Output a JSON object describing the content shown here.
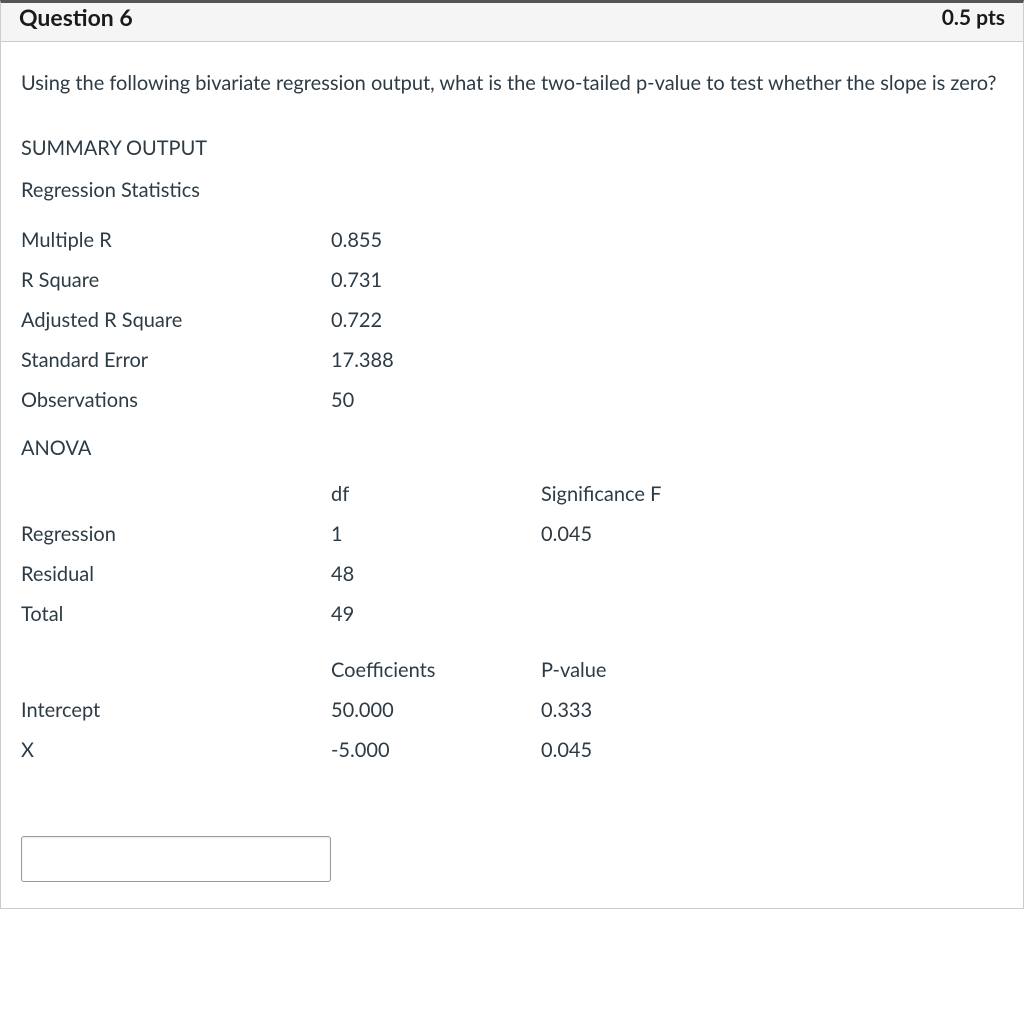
{
  "header": {
    "title": "Question 6",
    "points": "0.5 pts"
  },
  "prompt": "Using the following bivariate regression output, what is the two-tailed p-value to test whether the slope is zero?",
  "summary_heading": "SUMMARY OUTPUT",
  "stats_heading": "Regression Statistics",
  "reg_stats": [
    {
      "label": "Multiple R",
      "value": "0.855"
    },
    {
      "label": "R Square",
      "value": "0.731"
    },
    {
      "label": "Adjusted R Square",
      "value": "0.722"
    },
    {
      "label": "Standard Error",
      "value": "17.388"
    },
    {
      "label": "Observations",
      "value": "50"
    }
  ],
  "anova_heading": "ANOVA",
  "anova": {
    "header": {
      "c0": "",
      "c1": "df",
      "c2": "Significance F"
    },
    "rows": [
      {
        "c0": "Regression",
        "c1": "1",
        "c2": "0.045"
      },
      {
        "c0": "Residual",
        "c1": "48",
        "c2": ""
      },
      {
        "c0": "Total",
        "c1": "49",
        "c2": ""
      }
    ]
  },
  "coef": {
    "header": {
      "c0": "",
      "c1": "Coefficients",
      "c2": "P-value"
    },
    "rows": [
      {
        "c0": "Intercept",
        "c1": "50.000",
        "c2": "0.333"
      },
      {
        "c0": "X",
        "c1": "-5.000",
        "c2": "0.045"
      }
    ]
  },
  "answer": {
    "value": ""
  }
}
